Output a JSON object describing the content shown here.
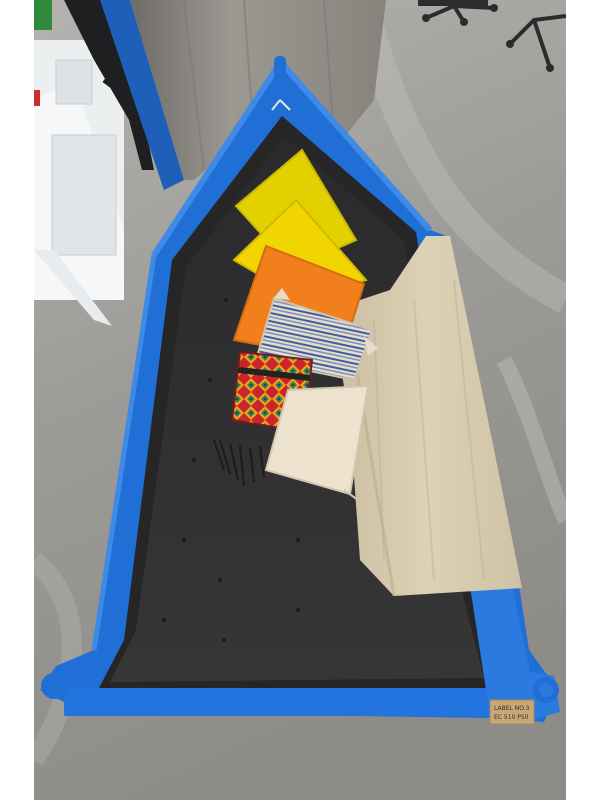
{
  "image": {
    "alt": "Blue wooden boat converted into a sofa with a dark tufted cushion, colorful pillows and a linen throw, on a polished concrete floor",
    "plate": {
      "line1": "LABEL NO.3",
      "line2": "EC 510 P50"
    },
    "colors": {
      "boat_blue": "#1f6fd6",
      "cushion": "#2f2f30",
      "floor": "#9d9c99",
      "pillar": "#8f8c86",
      "throw": "#d9cdb3",
      "pillow_yellow": "#e6d000",
      "pillow_orange": "#f07f1c"
    }
  }
}
